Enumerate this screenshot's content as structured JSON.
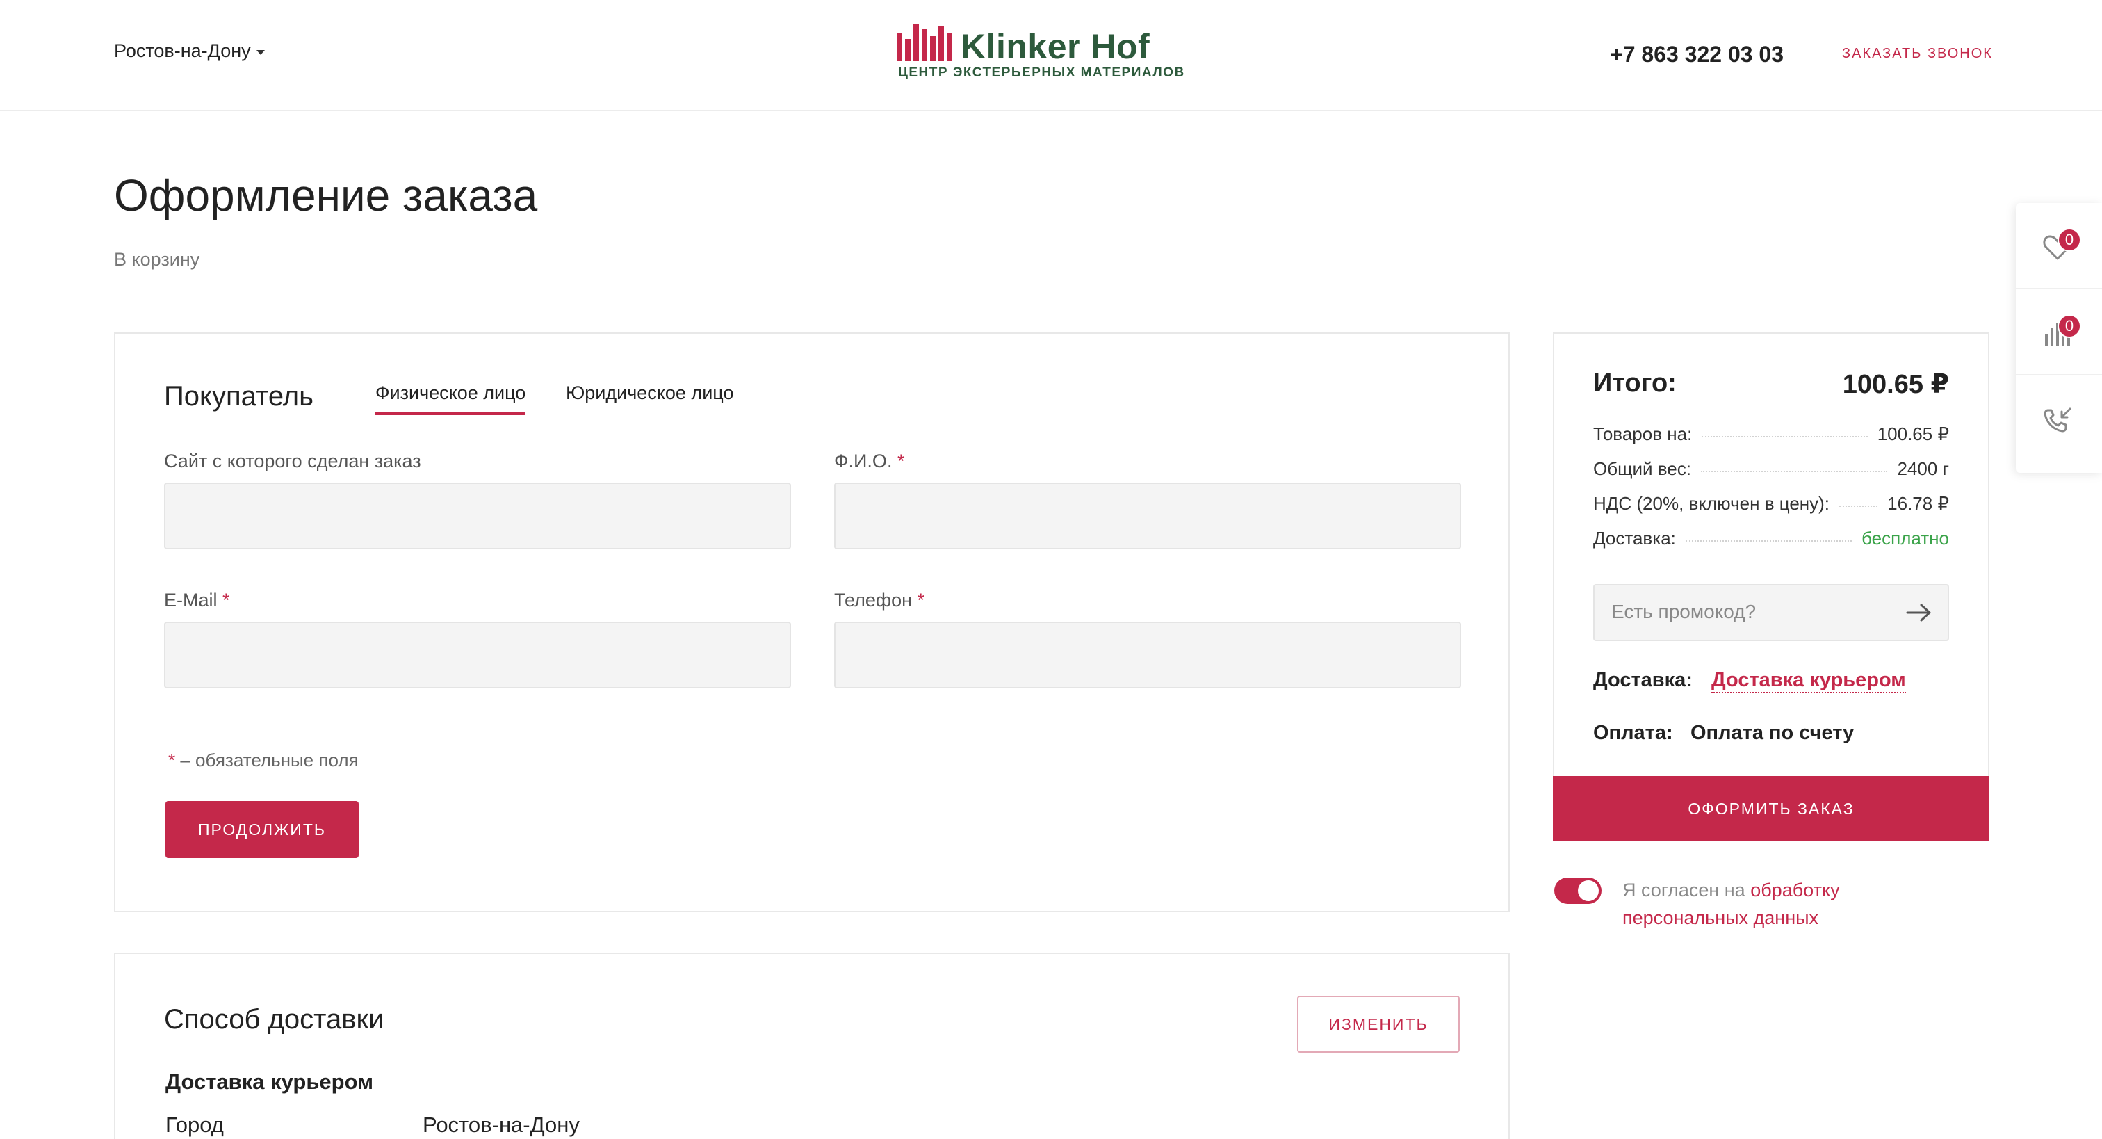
{
  "header": {
    "city": "Ростов-на-Дону",
    "logo_name": "Klinker Hof",
    "logo_sub": "ЦЕНТР ЭКСТЕРЬЕРНЫХ МАТЕРИАЛОВ",
    "phone": "+7 863 322 03 03",
    "callback": "ЗАКАЗАТЬ ЗВОНОК"
  },
  "page": {
    "title": "Оформление заказа",
    "back_link": "В корзину"
  },
  "buyer": {
    "title": "Покупатель",
    "tabs": [
      {
        "label": "Физическое лицо",
        "active": true
      },
      {
        "label": "Юридическое лицо",
        "active": false
      }
    ],
    "fields": [
      {
        "label": "Сайт с которого сделан заказ",
        "required": false,
        "value": ""
      },
      {
        "label": "Ф.И.О.",
        "required": true,
        "value": ""
      },
      {
        "label": "E-Mail",
        "required": true,
        "value": ""
      },
      {
        "label": "Телефон",
        "required": true,
        "value": ""
      }
    ],
    "required_mark": "*",
    "required_note": " – обязательные поля",
    "continue_label": "ПРОДОЛЖИТЬ"
  },
  "delivery_section": {
    "title": "Способ доставки",
    "change_label": "ИЗМЕНИТЬ",
    "method": "Доставка курьером",
    "city_label": "Город",
    "city_value": "Ростов-на-Дону"
  },
  "summary": {
    "total_label": "Итого:",
    "total_value": "100.65 ₽",
    "rows": [
      {
        "label": "Товаров на:",
        "value": "100.65 ₽"
      },
      {
        "label": "Общий вес:",
        "value": "2400 г"
      },
      {
        "label": "НДС (20%, включен в цену):",
        "value": "16.78 ₽"
      },
      {
        "label": "Доставка:",
        "value": "бесплатно"
      }
    ],
    "promo_placeholder": "Есть промокод?",
    "delivery_label": "Доставка:",
    "delivery_value": "Доставка курьером",
    "payment_label": "Оплата:",
    "payment_value": "Оплата по счету",
    "order_label": "ОФОРМИТЬ ЗАКАЗ"
  },
  "consent": {
    "text": "Я согласен на ",
    "link": "обработку персональных данных",
    "checked": true
  },
  "side_panel": {
    "favorites_count": "0",
    "compare_count": "0"
  },
  "colors": {
    "accent": "#c4284a",
    "brand_green": "#2d5a3c",
    "free_green": "#3aa349"
  }
}
